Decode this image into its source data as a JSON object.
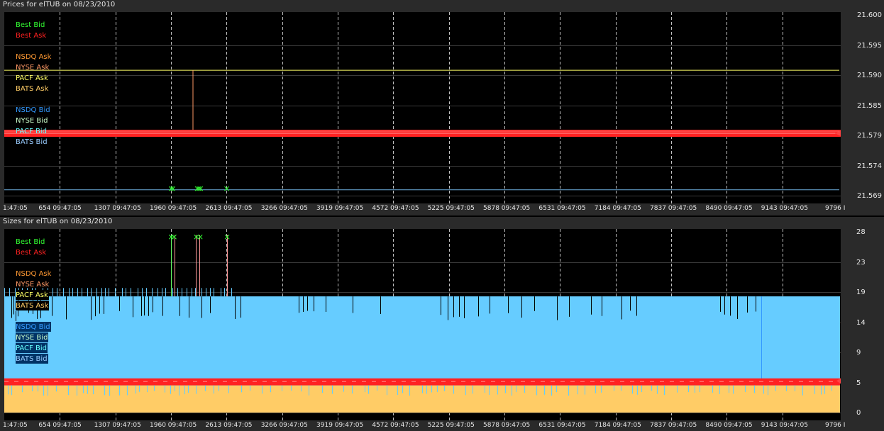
{
  "symbol": "elTUB",
  "date": "08/23/2010",
  "price_panel": {
    "title": "Prices for  elTUB  on  08/23/2010",
    "y_ticks": [
      "21.600",
      "21.595",
      "21.590",
      "21.585",
      "21.579",
      "21.574",
      "21.569"
    ],
    "legend": [
      {
        "label": "Best Bid",
        "color": "#33ff33"
      },
      {
        "label": "Best Ask",
        "color": "#ff2222"
      },
      {
        "label": "",
        "color": "#000000"
      },
      {
        "label": "NSDQ Ask",
        "color": "#ff9933"
      },
      {
        "label": "NYSE Ask",
        "color": "#ff9966"
      },
      {
        "label": "PACF Ask",
        "color": "#ffff66"
      },
      {
        "label": "BATS Ask",
        "color": "#ffcc66"
      },
      {
        "label": "",
        "color": "#000000"
      },
      {
        "label": "NSDQ Bid",
        "color": "#3399ff"
      },
      {
        "label": "NYSE Bid",
        "color": "#ccffcc"
      },
      {
        "label": "PACF Bid",
        "color": "#66ffff"
      },
      {
        "label": "BATS Bid",
        "color": "#99ccff"
      }
    ]
  },
  "size_panel": {
    "title": "Sizes for  elTUB  on  08/23/2010",
    "y_ticks": [
      "28",
      "23",
      "19",
      "14",
      "9",
      "5",
      "0"
    ],
    "legend": [
      {
        "label": "Best Bid",
        "color": "#33ff33"
      },
      {
        "label": "Best Ask",
        "color": "#ff2222"
      },
      {
        "label": "",
        "color": "#000000"
      },
      {
        "label": "NSDQ Ask",
        "color": "#ff9933"
      },
      {
        "label": "NYSE Ask",
        "color": "#ff9966"
      },
      {
        "label": "PACF Ask",
        "color": "#ffff66"
      },
      {
        "label": "BATS Ask",
        "color": "#ffcc66"
      },
      {
        "label": "",
        "color": "#000000"
      },
      {
        "label": "NSDQ Bid",
        "color": "#3399ff"
      },
      {
        "label": "NYSE Bid",
        "color": "#ccffcc"
      },
      {
        "label": "PACF Bid",
        "color": "#66ffff"
      },
      {
        "label": "BATS Bid",
        "color": "#99ccff"
      }
    ]
  },
  "x_ticks": [
    "1:47:05",
    "654 09:47:05",
    "1307 09:47:05",
    "1960 09:47:05",
    "2613 09:47:05",
    "3266 09:47:05",
    "3919 09:47:05",
    "4572 09:47:05",
    "5225 09:47:05",
    "5878 09:47:05",
    "6531 09:47:05",
    "7184 09:47:05",
    "7837 09:47:05",
    "8490 09:47:05",
    "9143 09:47:05",
    "9796 I"
  ],
  "chart_data": [
    {
      "type": "line",
      "title": "Prices for  elTUB  on  08/23/2010",
      "ylim": [
        21.569,
        21.6
      ],
      "xlim": [
        0,
        9796
      ],
      "series": [
        {
          "name": "PACF Ask",
          "color": "#ffff66",
          "x": [
            0,
            9796
          ],
          "y": [
            21.5905,
            21.5905
          ]
        },
        {
          "name": "Best Ask",
          "color": "#ff2222",
          "x": [
            0,
            9796
          ],
          "y": [
            21.5797,
            21.5797
          ]
        },
        {
          "name": "BATS Bid",
          "color": "#99ccff",
          "x": [
            0,
            9796
          ],
          "y": [
            21.57,
            21.57
          ]
        }
      ]
    },
    {
      "type": "area",
      "title": "Sizes for  elTUB  on  08/23/2010",
      "ylim": [
        0,
        28
      ],
      "xlim": [
        0,
        9796
      ],
      "series": [
        {
          "name": "BATS Bid",
          "color": "#66ccff",
          "x": [
            0,
            9796
          ],
          "y": [
            18,
            18
          ]
        },
        {
          "name": "Best Ask",
          "color": "#ff2222",
          "x": [
            0,
            9796
          ],
          "y": [
            5,
            5
          ]
        },
        {
          "name": "BATS Ask",
          "color": "#ffcc66",
          "x": [
            0,
            9796
          ],
          "y": [
            4,
            4
          ]
        }
      ]
    }
  ]
}
